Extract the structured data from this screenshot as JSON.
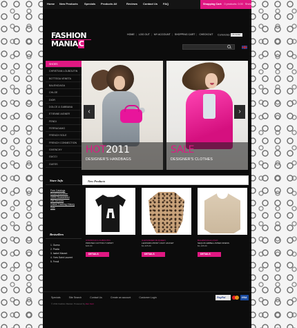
{
  "nav": {
    "items": [
      "Home",
      "New Products",
      "Specials",
      "Products All",
      "Reviews",
      "Contact Us",
      "FAQ"
    ]
  },
  "cart": {
    "label": "Shopping Cart:",
    "status": "0 products: 0.00",
    "action": "Show Cart"
  },
  "logo": {
    "line1": "FASHION",
    "line2": "MANIA",
    "accent": "C"
  },
  "header_links": [
    "HOME",
    "LOG OUT",
    "MY ACCOUNT",
    "SHOPPING CART",
    "CHECKOUT"
  ],
  "currencies": {
    "label": "Currencies:",
    "value": "US Dollar"
  },
  "categories": [
    "SHOES",
    "CHRISTIAN LOUBOUTIN",
    "BOTTEGA VENETA",
    "BALENCIAGA",
    "CHLOE",
    "DIOR",
    "DOLCE & GABBANA",
    "ETIENNE AIGNER",
    "FENDI",
    "FERRAGAMO",
    "FRENCH SOLE",
    "FRENCH CONNECTION",
    "GIVENCHY",
    "GUCCI",
    "GUESS",
    "JESSICA SIMPSON"
  ],
  "slides": [
    {
      "title_a": "HOT",
      "title_b": "2011",
      "subtitle": "DESIGNER'S HANDBAGS"
    },
    {
      "title_a": "SALE",
      "title_b": "",
      "subtitle": "DESIGNER'S CLOTHES"
    }
  ],
  "store_info": {
    "title": "Store Info",
    "links": [
      "Free Catalogs",
      "Email Newsletter",
      "100% Guaranteed",
      "Gift Services",
      "Online Tracking History",
      "Sale"
    ]
  },
  "bestsellers": {
    "title": "Bestsellers",
    "items": [
      "1.  Guess",
      "2.  Prada",
      "3.  Isabel Marant",
      "4.  Yves Saint Laurent",
      "5.  Fendi"
    ]
  },
  "new_products": {
    "title": "New Products",
    "items": [
      {
        "brand": "CHRISTIAN LOUBOUTIN",
        "name": "PRINTED COTTON T-SHIRT",
        "price": "$29.00",
        "button": "DETAILS"
      },
      {
        "brand": "ALEXANDER McQUEEN",
        "name": "LEOPARD-PRINT COAT JACKET",
        "price": "$1,325.00",
        "button": "DETAILS"
      },
      {
        "brand": "BALENCIAGA LOGO",
        "name": "SEQUIN EMBELLISHED DRESS",
        "price": "$1,195.00",
        "button": "DETAILS"
      }
    ]
  },
  "footer": {
    "links": [
      "Specials",
      "Site Search",
      "Contact Us",
      "Create an account",
      "Customer Login"
    ],
    "copyright_a": "© 2011 Fashion Maniac. Powered by ",
    "copyright_b": "Zen Cart",
    "pay": {
      "paypal": "PayPal",
      "visa": "VISA"
    }
  },
  "colors": {
    "accent": "#e01882",
    "background": "#0c0c0c"
  }
}
